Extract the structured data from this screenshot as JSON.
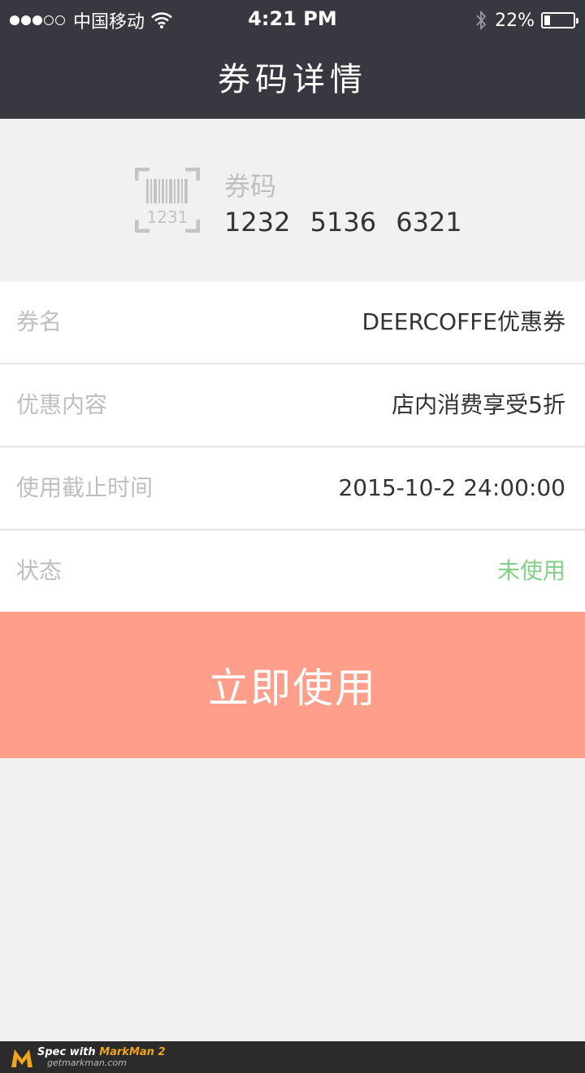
{
  "status_bar": {
    "carrier": "中国移动",
    "time": "4:21 PM",
    "battery_percent": "22%",
    "battery_level": 0.22,
    "signal_dots_filled": 3,
    "signal_dots_total": 5
  },
  "nav": {
    "title": "券码详情"
  },
  "code": {
    "icon_number": "1231",
    "label": "券码",
    "value": "1232  5136  6321"
  },
  "details": [
    {
      "label": "券名",
      "value": "DEERCOFFE优惠券"
    },
    {
      "label": "优惠内容",
      "value": "店内消费享受5折"
    },
    {
      "label": "使用截止时间",
      "value": "2015-10-2  24:00:00"
    },
    {
      "label": "状态",
      "value": "未使用"
    }
  ],
  "use_button": {
    "label": "立即使用"
  },
  "footer": {
    "line1_prefix": "Spec with ",
    "line1_brand": "MarkMan 2",
    "line2": "getmarkman.com"
  },
  "colors": {
    "header_bg": "#383840",
    "page_bg": "#f1f1f1",
    "label_text": "#bfbfbf",
    "value_text": "#333333",
    "divider": "#e3e3e3",
    "status_unused": "#84cf89",
    "button_bg": "#fe9e8b"
  },
  "icons": {
    "barcode": "barcode-icon",
    "wifi": "wifi-icon",
    "bluetooth": "bluetooth-icon",
    "battery": "battery-icon"
  }
}
